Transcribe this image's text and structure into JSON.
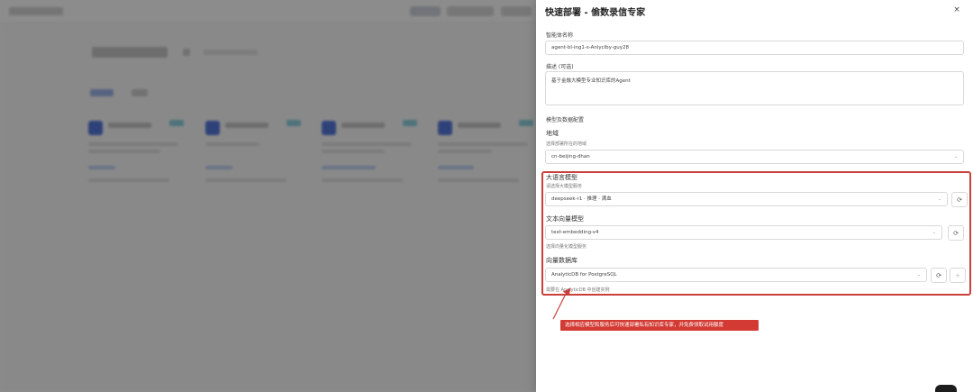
{
  "drawer": {
    "title": "快速部署 - 偷数录信专家",
    "close": "×"
  },
  "form": {
    "agent_name_label": "智能体名称",
    "agent_name_value": "agent-bl-ing1-s-Anlyclby-guy28",
    "description_label": "描述 (可选)",
    "description_value": "基于金融大模型专业知识库的Agent",
    "section_label": "模型及数据配置",
    "region": {
      "label": "地域",
      "hint": "选择部署所在的地域",
      "value": "cn-beijing-dhan"
    },
    "llm": {
      "label": "大语言模型",
      "hint": "请选择大模型服务",
      "value": "deepseek-r1 · 推理 · 满血"
    },
    "embedding": {
      "label": "文本向量模型",
      "value": "text-embedding-v4",
      "hint": "选择向量化模型服务"
    },
    "vector_db": {
      "label": "向量数据库",
      "value": "AnalyticDB for PostgreSQL",
      "hint": "需要在 AnalyticDB 中创建实例"
    }
  },
  "annotation": {
    "callout": "选择相应模型和服务后可快速部署私有知识库专家，并免费领取试用额度"
  },
  "icons": {
    "refresh": "⟳",
    "add": "+",
    "chevron": "⌄"
  },
  "colors": {
    "highlight": "#c9403a",
    "callout_bg": "#d33a33",
    "brand_blue": "#2a59d6"
  }
}
